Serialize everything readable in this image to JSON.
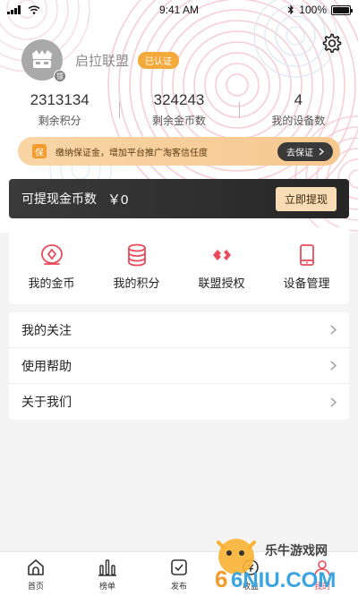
{
  "status_bar": {
    "time": "9:41 AM",
    "battery": "100%"
  },
  "profile": {
    "name": "启拉联盟",
    "verified": "已认证",
    "badge": "镖"
  },
  "stats": [
    {
      "value": "2313134",
      "label": "剩余积分"
    },
    {
      "value": "324243",
      "label": "剩余金币数"
    },
    {
      "value": "4",
      "label": "我的设备数"
    }
  ],
  "deposit": {
    "icon_text": "保",
    "text": "缴纳保证金，增加平台推广淘客信任度",
    "button": "去保证"
  },
  "withdraw": {
    "label": "可提现金币数",
    "amount": "￥0",
    "button": "立即提现"
  },
  "features": [
    {
      "label": "我的金币",
      "icon": "coin-icon"
    },
    {
      "label": "我的积分",
      "icon": "database-icon"
    },
    {
      "label": "联盟授权",
      "icon": "link-icon"
    },
    {
      "label": "设备管理",
      "icon": "phone-icon"
    }
  ],
  "menu": [
    {
      "label": "我的关注"
    },
    {
      "label": "使用帮助"
    },
    {
      "label": "关于我们"
    }
  ],
  "tabs": [
    {
      "label": "首页",
      "icon": "home-icon"
    },
    {
      "label": "榜单",
      "icon": "bar-chart-icon"
    },
    {
      "label": "发布",
      "icon": "publish-icon"
    },
    {
      "label": "收益",
      "icon": "earnings-icon"
    },
    {
      "label": "我的",
      "icon": "user-icon"
    }
  ],
  "watermark": {
    "text": "乐牛游戏网",
    "logo": "6NIU.COM"
  },
  "colors": {
    "accent": "#e84b5c",
    "gold": "#f4a93c",
    "dark": "#2e2e2e"
  }
}
